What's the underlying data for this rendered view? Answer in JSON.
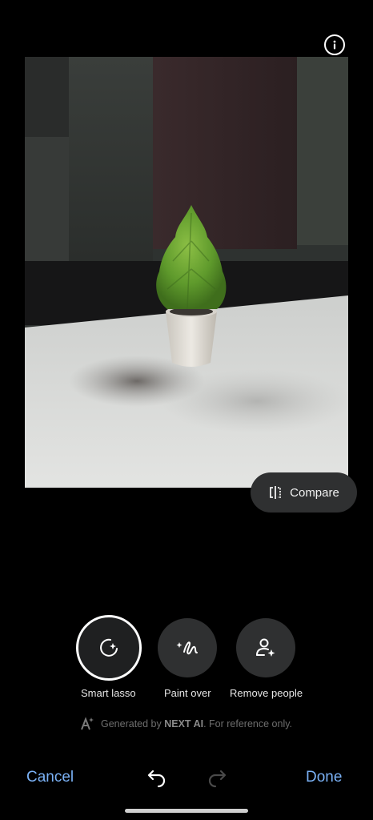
{
  "header": {
    "info_icon": "info-icon"
  },
  "compare": {
    "label": "Compare",
    "icon": "compare-icon"
  },
  "tools": [
    {
      "label": "Smart lasso",
      "icon": "smart-lasso-icon",
      "selected": true
    },
    {
      "label": "Paint over",
      "icon": "paint-over-icon",
      "selected": false
    },
    {
      "label": "Remove people",
      "icon": "remove-people-icon",
      "selected": false
    }
  ],
  "disclaimer": {
    "prefix": "Generated by",
    "brand": "NEXT AI",
    "suffix": ". For reference only.",
    "icon": "ai-sparkle-icon"
  },
  "bottom_bar": {
    "cancel_label": "Cancel",
    "done_label": "Done",
    "undo_icon": "undo-icon",
    "redo_icon": "redo-icon"
  },
  "colors": {
    "accent": "#7ab1f5",
    "background": "#000000",
    "tool_bg": "#2f3031"
  }
}
